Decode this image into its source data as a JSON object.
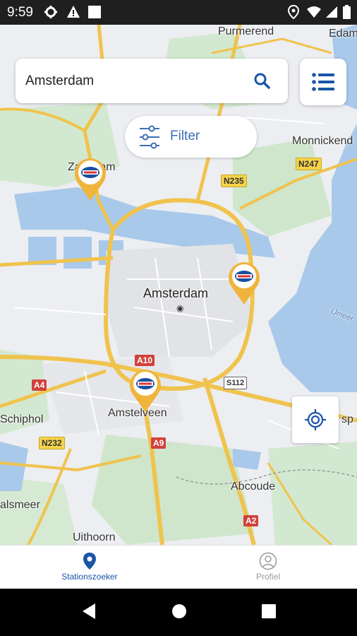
{
  "status_bar": {
    "time": "9:59",
    "icons": [
      "settings-icon",
      "warning-icon",
      "square-icon",
      "location-icon",
      "wifi-icon",
      "signal-icon",
      "battery-icon"
    ]
  },
  "search": {
    "value": "Amsterdam",
    "placeholder": ""
  },
  "filter": {
    "label": "Filter"
  },
  "map": {
    "labels": {
      "purmerend": "Purmerend",
      "edam": "Edam",
      "monnickendam": "Monnickend",
      "zaandam": "Zaandam",
      "amsterdam": "Amsterdam",
      "schiphol": "Schiphol",
      "amstelveen": "Amstelveen",
      "abcoude": "Abcoude",
      "aalsmeer": "alsmeer",
      "uithoorn": "Uithoorn",
      "ijmeer": "IJmeer",
      "right_edge": "sp"
    },
    "shields": {
      "n235": "N235",
      "n247": "N247",
      "a10": "A10",
      "a4": "A4",
      "s112": "S112",
      "n232": "N232",
      "a9": "A9",
      "a2": "A2"
    },
    "pin_count": 3,
    "colors": {
      "water": "#a9c9ea",
      "land": "#eef0f2",
      "green": "#cfe6cf",
      "road": "#f0c34e",
      "pin": "#f0b43c"
    }
  },
  "bottom_nav": {
    "items": [
      {
        "label": "Stationszoeker",
        "icon": "location-pin-icon",
        "active": true
      },
      {
        "label": "Profiel",
        "icon": "profile-icon",
        "active": false
      }
    ],
    "active_color": "#1a55a8"
  },
  "system_nav": [
    "back-icon",
    "home-icon",
    "recents-icon"
  ]
}
